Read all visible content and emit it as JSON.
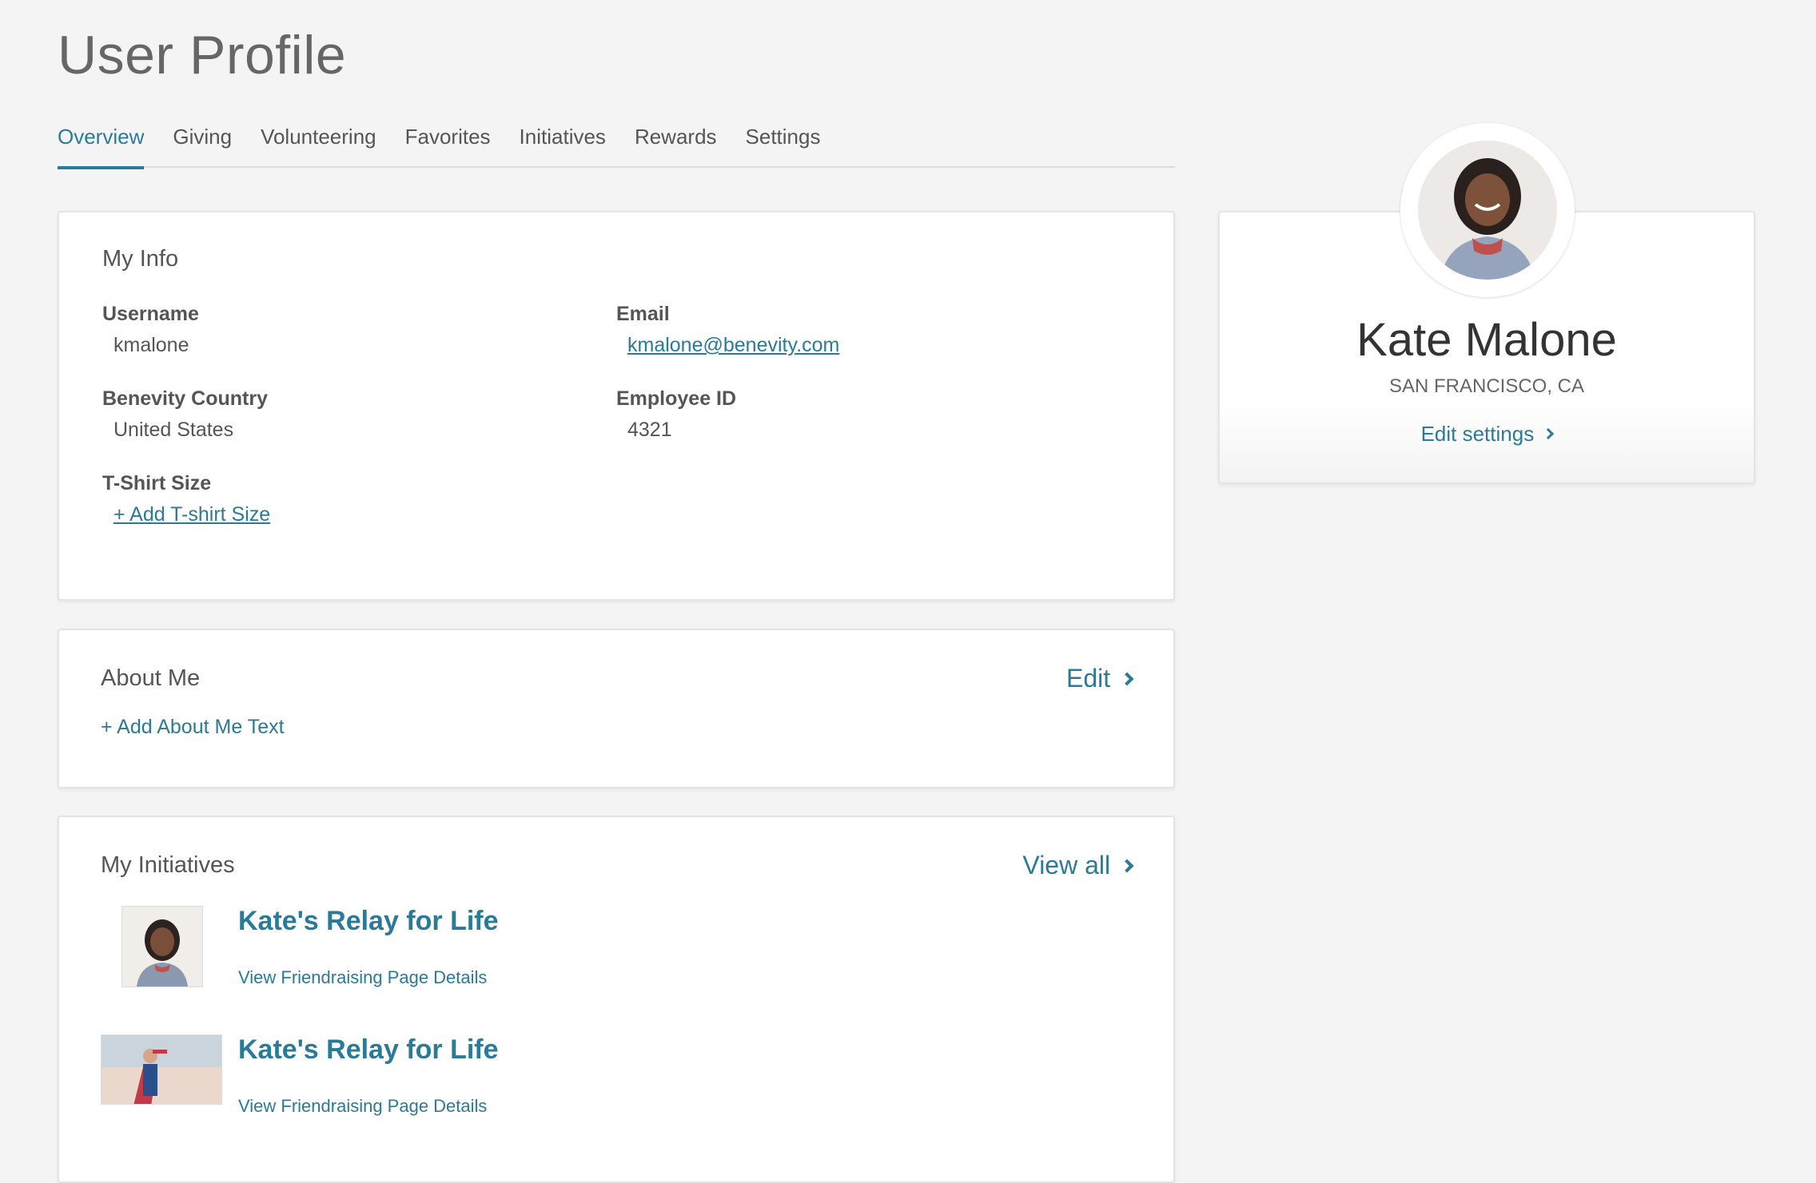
{
  "page": {
    "title": "User Profile"
  },
  "tabs": [
    {
      "label": "Overview",
      "active": true
    },
    {
      "label": "Giving"
    },
    {
      "label": "Volunteering"
    },
    {
      "label": "Favorites"
    },
    {
      "label": "Initiatives"
    },
    {
      "label": "Rewards"
    },
    {
      "label": "Settings"
    }
  ],
  "my_info": {
    "title": "My Info",
    "username": {
      "label": "Username",
      "value": "kmalone"
    },
    "email": {
      "label": "Email",
      "value": "kmalone@benevity.com"
    },
    "country": {
      "label": "Benevity Country",
      "value": "United States"
    },
    "employee_id": {
      "label": "Employee ID",
      "value": "4321"
    },
    "tshirt": {
      "label": "T-Shirt Size",
      "action": "+ Add T-shirt Size"
    }
  },
  "about_me": {
    "title": "About Me",
    "edit_label": "Edit",
    "add_label": "+ Add About Me Text"
  },
  "initiatives": {
    "title": "My Initiatives",
    "view_all_label": "View all",
    "items": [
      {
        "title": "Kate's Relay for Life",
        "link": "View Friendraising Page Details"
      },
      {
        "title": "Kate's Relay for Life",
        "link": "View Friendraising Page Details"
      }
    ]
  },
  "profile": {
    "first_name": "Kate",
    "last_name": "Malone",
    "location": "SAN FRANCISCO, CA",
    "edit_settings_label": "Edit settings"
  },
  "colors": {
    "accent": "#2a7a9a",
    "background": "#f4f4f4"
  },
  "icons": {
    "chevron": "chevron-right-icon"
  }
}
